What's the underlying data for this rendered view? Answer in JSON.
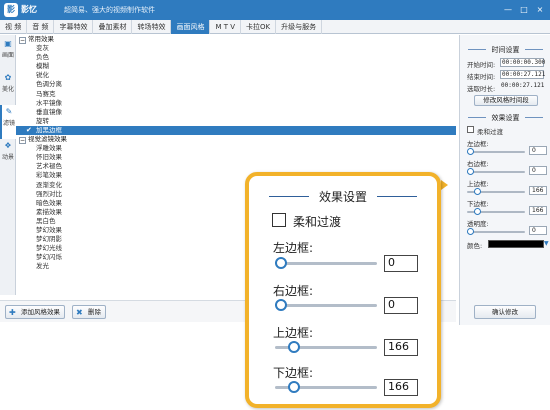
{
  "titlebar": {
    "logo": "影",
    "app_name": "影忆",
    "slogan": "超简易、强大的视频制作软件",
    "buttons": [
      "—",
      "□",
      "×"
    ]
  },
  "tabs": [
    {
      "label": "视 频",
      "active": false
    },
    {
      "label": "音 频",
      "active": false
    },
    {
      "label": "字幕特效",
      "active": false
    },
    {
      "label": "叠加素材",
      "active": false
    },
    {
      "label": "转场特效",
      "active": false
    },
    {
      "label": "画面风格",
      "active": true
    },
    {
      "label": "M T V",
      "active": false
    },
    {
      "label": "卡拉OK",
      "active": false
    },
    {
      "label": "升级与服务",
      "active": false
    }
  ],
  "side_tabs": [
    {
      "label": "画面",
      "icon": "▣"
    },
    {
      "label": "美化",
      "icon": "✿"
    },
    {
      "label": "滤镜",
      "icon": "✎"
    },
    {
      "label": "动景",
      "icon": "❖"
    }
  ],
  "tree": {
    "groups": [
      {
        "name": "常用效果",
        "items": [
          "变灰",
          "负色",
          "模糊",
          "锐化",
          "色调分离",
          "马赛克",
          "水平镜像",
          "垂直镜像",
          "旋转",
          "加黑边框"
        ],
        "selected": "加黑边框"
      },
      {
        "name": "视觉滤镜效果",
        "items": [
          "浮雕效果",
          "怀旧效果",
          "艺术褪色",
          "彩笔效果",
          "逐渐变化",
          "强烈对比",
          "暗色效果",
          "素描效果",
          "黑白色",
          "梦幻效果",
          "梦幻阴影",
          "梦幻光线",
          "梦幻闪烁",
          "发光"
        ]
      }
    ]
  },
  "bottom_buttons": {
    "add_style": "添加风格效果",
    "delete": "删除"
  },
  "right_panel": {
    "time_section_title": "时间设置",
    "start_label": "开始时间:",
    "start_value": "00:00:00.300",
    "end_label": "结束时间:",
    "end_value": "00:00:27.121",
    "duration_label": "选取时长:",
    "duration_value": "00:00:27.121",
    "modify_time_btn": "修改风格时间段",
    "effect_section_title": "效果设置",
    "smooth_label": "柔和过渡",
    "left_label": "左边框:",
    "left_value": "0",
    "right_label": "右边框:",
    "right_value": "0",
    "top_label": "上边框:",
    "top_value": "166",
    "bottom_label": "下边框:",
    "bottom_value": "166",
    "opacity_label": "透明度:",
    "opacity_value": "0",
    "color_label": "颜色:",
    "color_value": "#000000",
    "confirm_btn": "确认修改"
  },
  "zoom": {
    "title": "效果设置",
    "smooth_label": "柔和过渡",
    "smooth_checked": false,
    "fields": [
      {
        "label": "左边框:",
        "value": "0"
      },
      {
        "label": "右边框:",
        "value": "0"
      },
      {
        "label": "上边框:",
        "value": "166"
      },
      {
        "label": "下边框:",
        "value": "166"
      }
    ]
  },
  "colors": {
    "accent": "#2f7bbf",
    "callout_border": "#f2b22a"
  }
}
